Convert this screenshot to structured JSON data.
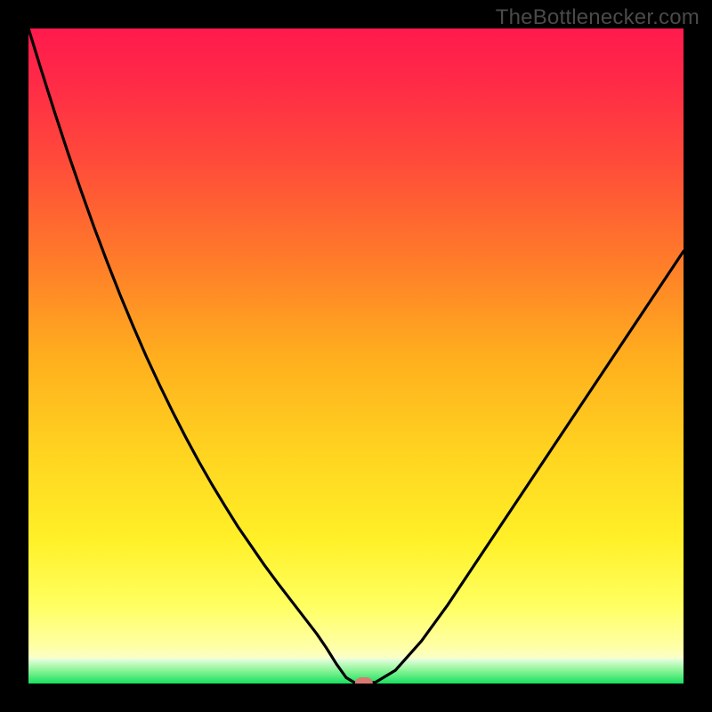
{
  "watermark": "TheBottlenecker.com",
  "chart_data": {
    "type": "line",
    "title": "",
    "xlabel": "",
    "ylabel": "",
    "xlim": [
      0,
      100
    ],
    "ylim": [
      0,
      100
    ],
    "x": [
      0,
      2,
      4,
      6,
      8,
      10,
      12,
      14,
      16,
      18,
      20,
      22,
      24,
      26,
      28,
      30,
      32,
      34,
      36,
      38,
      40,
      42,
      44,
      45.5,
      47,
      48.5,
      50,
      51,
      53,
      56,
      60,
      64,
      68,
      72,
      76,
      80,
      84,
      88,
      92,
      96,
      100
    ],
    "values": [
      100,
      93.5,
      87.2,
      81.1,
      75.3,
      69.7,
      64.4,
      59.3,
      54.5,
      49.9,
      45.6,
      41.5,
      37.6,
      33.9,
      30.4,
      27.1,
      23.9,
      21.0,
      18.1,
      15.4,
      12.8,
      10.2,
      7.6,
      5.4,
      3.0,
      0.9,
      0.0,
      0.0,
      0.2,
      2.0,
      6.5,
      12.0,
      18.0,
      24.0,
      30.0,
      36.0,
      42.0,
      48.0,
      54.0,
      60.0,
      66.0
    ],
    "marker": {
      "x": 51.2,
      "y": 0.0
    },
    "background": "red-green-gradient",
    "green_band_top_fraction": 0.962
  }
}
